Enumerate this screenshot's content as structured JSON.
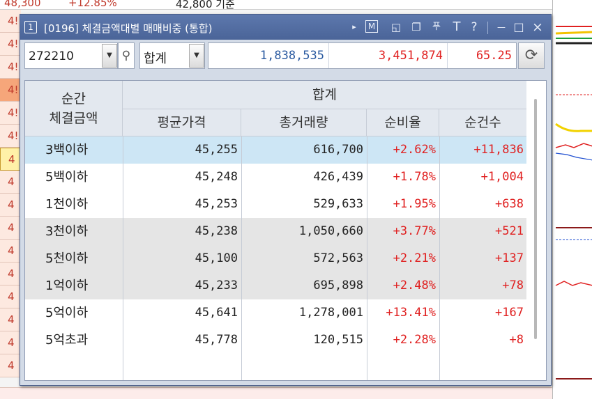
{
  "background": {
    "top_price": "48,300",
    "top_change": "+12.85%",
    "top_basis": "42,800 기준",
    "left_prices": [
      "4!",
      "4!",
      "4!",
      "4!",
      "4!",
      "4!",
      "4",
      "4",
      "4",
      "4",
      "4",
      "4",
      "4",
      "4",
      "4",
      "4"
    ]
  },
  "window": {
    "number": "1",
    "title": "[0196] 체결금액대별 매매비중 (통합)",
    "icons": {
      "play": "▸",
      "m": "M",
      "restore": "◱",
      "dup": "❐",
      "pin": "푸",
      "font": "T",
      "help": "?",
      "minimize": "—",
      "maximize": "□",
      "close": "×"
    }
  },
  "toolbar": {
    "stock_code": "272210",
    "dropdown_arrow": "▼",
    "search_icon": "⚲",
    "category": "합계",
    "summary_volume_buy": "1,838,535",
    "summary_volume_sell": "3,451,874",
    "summary_ratio": "65.25",
    "refresh_icon": "⟳"
  },
  "table": {
    "header_main": [
      "순간",
      "체결금액"
    ],
    "header_group": "합계",
    "columns": [
      "평균가격",
      "총거래량",
      "순비율",
      "순건수"
    ],
    "rows": [
      {
        "label": "3백이하",
        "avg_price": "45,255",
        "volume": "616,700",
        "ratio": "+2.62%",
        "count": "+11,836"
      },
      {
        "label": "5백이하",
        "avg_price": "45,248",
        "volume": "426,439",
        "ratio": "+1.78%",
        "count": "+1,004"
      },
      {
        "label": "1천이하",
        "avg_price": "45,253",
        "volume": "529,633",
        "ratio": "+1.95%",
        "count": "+638"
      },
      {
        "label": "3천이하",
        "avg_price": "45,238",
        "volume": "1,050,660",
        "ratio": "+3.77%",
        "count": "+521"
      },
      {
        "label": "5천이하",
        "avg_price": "45,100",
        "volume": "572,563",
        "ratio": "+2.21%",
        "count": "+137"
      },
      {
        "label": "1억이하",
        "avg_price": "45,233",
        "volume": "695,898",
        "ratio": "+2.48%",
        "count": "+78"
      },
      {
        "label": "5억이하",
        "avg_price": "45,641",
        "volume": "1,278,001",
        "ratio": "+13.41%",
        "count": "+167"
      },
      {
        "label": "5억초과",
        "avg_price": "45,778",
        "volume": "120,515",
        "ratio": "+2.28%",
        "count": "+8"
      }
    ]
  },
  "colors": {
    "titlebar": "#4a6498",
    "positive": "#e02020",
    "summary_blue": "#2a5aa0",
    "row_highlight": "#cde6f5",
    "row_gray": "#e5e5e5"
  }
}
